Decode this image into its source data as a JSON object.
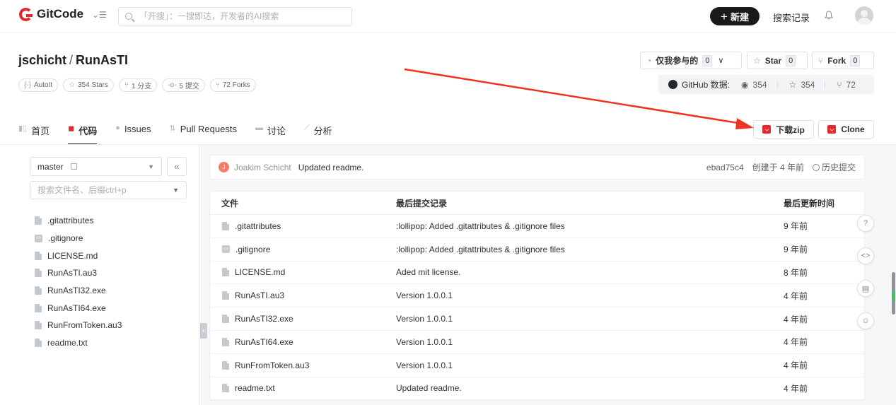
{
  "nav": {
    "logo_text": "GitCode",
    "search_placeholder": "「开搜」：一搜即达，开发者的AI搜索",
    "new_label": "新建",
    "search_history_label": "搜索记录"
  },
  "repo": {
    "owner": "jschicht",
    "name": "RunAsTI",
    "tags": [
      {
        "icon": "{-}",
        "label": "AutoIt"
      },
      {
        "icon": "☆",
        "label": "354 Stars"
      },
      {
        "icon": "⑂",
        "label": "1 分支"
      },
      {
        "icon": "-o-",
        "label": "5 提交"
      },
      {
        "icon": "⑂",
        "label": "72 Forks"
      }
    ]
  },
  "actions": {
    "watch_label": "仅我参与的",
    "watch_count": "0",
    "star_label": "Star",
    "star_count": "0",
    "fork_label": "Fork",
    "fork_count": "0"
  },
  "github": {
    "label": "GitHub 数据:",
    "watchers": "354",
    "stars": "354",
    "forks": "72"
  },
  "tabs": [
    {
      "label": "首页",
      "icon": "▮▯"
    },
    {
      "label": "代码",
      "icon": "◼"
    },
    {
      "label": "Issues",
      "icon": "●"
    },
    {
      "label": "Pull Requests",
      "icon": "⇅"
    },
    {
      "label": "讨论",
      "icon": "▬"
    },
    {
      "label": "分析",
      "icon": "⟋"
    }
  ],
  "buttons": {
    "download": "下载zip",
    "clone": "Clone"
  },
  "sidebar": {
    "branch": "master",
    "file_search_placeholder": "搜索文件名、后缀ctrl+p",
    "files": [
      ".gitattributes",
      ".gitignore",
      "LICENSE.md",
      "RunAsTI.au3",
      "RunAsTI32.exe",
      "RunAsTI64.exe",
      "RunFromToken.au3",
      "readme.txt"
    ]
  },
  "commit": {
    "avatar_letter": "J",
    "author": "Joakim Schicht",
    "message": "Updated readme.",
    "hash": "ebad75c4",
    "created": "创建于 4 年前",
    "history": "历史提交"
  },
  "table": {
    "headers": [
      "文件",
      "最后提交记录",
      "最后更新时间"
    ],
    "rows": [
      {
        "name": ".gitattributes",
        "msg": ":lollipop: Added .gitattributes & .gitignore files",
        "time": "9 年前"
      },
      {
        "name": ".gitignore",
        "msg": ":lollipop: Added .gitattributes & .gitignore files",
        "time": "9 年前"
      },
      {
        "name": "LICENSE.md",
        "msg": "Aded mit license.",
        "time": "8 年前"
      },
      {
        "name": "RunAsTI.au3",
        "msg": "Version 1.0.0.1",
        "time": "4 年前"
      },
      {
        "name": "RunAsTI32.exe",
        "msg": "Version 1.0.0.1",
        "time": "4 年前"
      },
      {
        "name": "RunAsTI64.exe",
        "msg": "Version 1.0.0.1",
        "time": "4 年前"
      },
      {
        "name": "RunFromToken.au3",
        "msg": "Version 1.0.0.1",
        "time": "4 年前"
      },
      {
        "name": "readme.txt",
        "msg": "Updated readme.",
        "time": "4 年前"
      }
    ]
  },
  "colors": {
    "brand_red": "#e4292e",
    "annotation_arrow": "#ee3322"
  }
}
